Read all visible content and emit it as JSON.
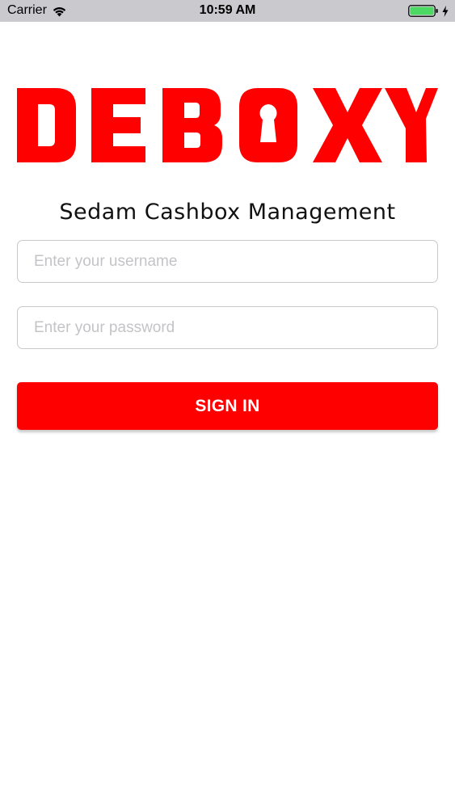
{
  "status_bar": {
    "carrier": "Carrier",
    "time": "10:59 AM",
    "icons": [
      "wifi-icon",
      "battery-icon",
      "charging-bolt-icon"
    ],
    "battery_color": "#4cd964"
  },
  "logo": {
    "text": "DEBOXY",
    "color": "#ff0000"
  },
  "subtitle": "Sedam Cashbox Management",
  "form": {
    "username_placeholder": "Enter your username",
    "password_placeholder": "Enter your password",
    "signin_label": "SIGN IN"
  },
  "colors": {
    "brand_red": "#ff0000",
    "status_bar_bg": "#c9c9ce",
    "placeholder": "#c4c4c8"
  }
}
